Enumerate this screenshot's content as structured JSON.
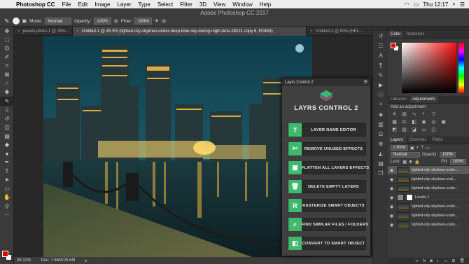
{
  "menubar": {
    "app": "Photoshop CC",
    "items": [
      "File",
      "Edit",
      "Image",
      "Layer",
      "Type",
      "Select",
      "Filter",
      "3D",
      "View",
      "Window",
      "Help"
    ],
    "clock": "Thu 12:17"
  },
  "window_title": "Adobe Photoshop CC 2017",
  "options": {
    "mode_label": "Mode:",
    "mode_value": "Normal",
    "opacity_label": "Opacity:",
    "opacity_value": "100%",
    "flow_label": "Flow:",
    "flow_value": "100%"
  },
  "tabs": [
    {
      "label": "pexels-photo-1 @ 25%..."
    },
    {
      "label": "Untitled-1 @ 45.3% (lighted-city-skylines-under-deep-blue-sky-during-night-time-28221 copy 6, RGB/8)"
    },
    {
      "label": "Untitled-2 @ 50% (HEL..."
    }
  ],
  "status": {
    "zoom": "45.31%",
    "doc": "Doc: 7.66M/25.6M"
  },
  "layrs": {
    "header": "Layrs Control 2",
    "title": "LAYRS CONTROL 2",
    "buttons": [
      {
        "label": "LAYER NAME EDITOR",
        "icon": "T"
      },
      {
        "label": "REMOVE UNUSED EFFECTS",
        "icon": "✂"
      },
      {
        "label": "FLATTEN ALL LAYERS EFFECTS",
        "icon": "▣"
      },
      {
        "label": "DELETE EMPTY LAYERS",
        "icon": "🗑"
      },
      {
        "label": "RASTERIZE SMART OBJECTS",
        "icon": "R"
      },
      {
        "label": "FIND SIMILAR FILES / FOLDERS",
        "icon": "⌕"
      },
      {
        "label": "CONVERT TO SMART OBJECT",
        "icon": "◧"
      }
    ]
  },
  "panels": {
    "color_tabs": [
      "Color",
      "Swatches"
    ],
    "adj_tabs": [
      "Libraries",
      "Adjustments"
    ],
    "adj_title": "Add an adjustment",
    "layer_tabs": [
      "Layers",
      "Channels",
      "Paths"
    ],
    "kind_label": "Kind",
    "blend_value": "Normal",
    "opacity_label": "Opacity:",
    "opacity_value": "100%",
    "lock_label": "Lock:",
    "fill_label": "Fill:",
    "fill_value": "100%",
    "layers": [
      {
        "name": "lighted-city-skylines-unde...",
        "type": "image",
        "selected": true
      },
      {
        "name": "lighted-city-skylines-und...",
        "type": "image",
        "selected": false
      },
      {
        "name": "lighted-city-skylines-unde...",
        "type": "image",
        "selected": false
      },
      {
        "name": "Levels 1",
        "type": "adjustment",
        "selected": false
      },
      {
        "name": "lighted-city-skylines-unde...",
        "type": "image",
        "selected": false
      },
      {
        "name": "lighted-city-skylines-unde...",
        "type": "image",
        "selected": false
      },
      {
        "name": "lighted-city-skylines-unde...",
        "type": "image",
        "selected": false
      }
    ]
  },
  "colors": {
    "accent_green": "#3fb96d",
    "foreground": "#e00000",
    "background": "#ffffff"
  }
}
